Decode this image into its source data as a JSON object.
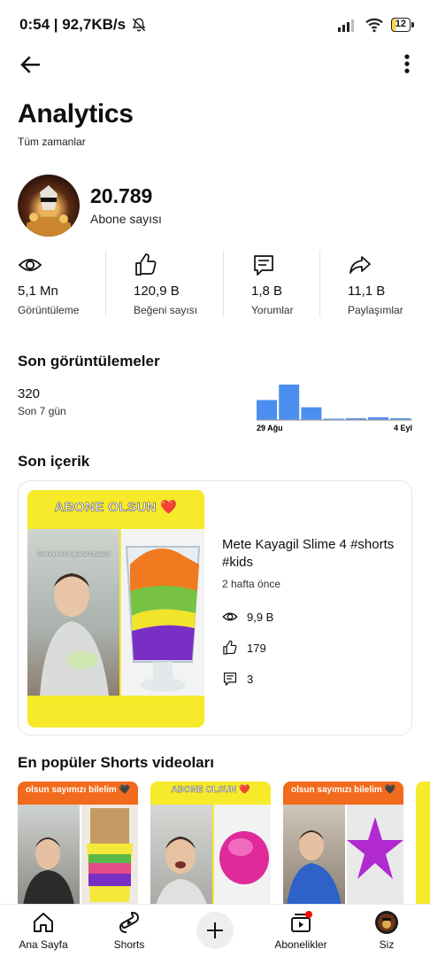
{
  "status_bar": {
    "time_speed": "0:54 | 92,7KB/s",
    "battery": "12"
  },
  "header": {
    "title": "Analytics",
    "subtitle": "Tüm zamanlar"
  },
  "channel": {
    "subscribers": "20.789",
    "subscribers_label": "Abone sayısı"
  },
  "stats": [
    {
      "value": "5,1 Mn",
      "label": "Görüntüleme",
      "icon": "eye-icon"
    },
    {
      "value": "120,9 B",
      "label": "Beğeni sayısı",
      "icon": "thumbs-up-icon"
    },
    {
      "value": "1,8 B",
      "label": "Yorumlar",
      "icon": "comment-icon"
    },
    {
      "value": "11,1 B",
      "label": "Paylaşımlar",
      "icon": "share-icon"
    }
  ],
  "recent_views": {
    "heading": "Son görüntülemeler",
    "value": "320",
    "period": "Son 7 gün",
    "chart_data": {
      "type": "bar",
      "x_start_label": "29 Ağu",
      "x_end_label": "4 Eyl",
      "values": [
        22,
        39,
        14,
        1,
        2,
        3,
        2
      ],
      "colors": {
        "bar": "#4a8ef0",
        "baseline": "#9e9e9e"
      }
    }
  },
  "recent_content": {
    "heading": "Son içerik",
    "thumbnail_banner": "ABONE OLSUN ❤️",
    "thumbnail_caption": "Sınıfa yeni biri gelirse Ortaokul",
    "title": "Mete Kayagil Slime 4 #shorts #kids",
    "age": "2 hafta önce",
    "views": "9,9 B",
    "likes": "179",
    "comments": "3"
  },
  "popular_shorts": {
    "heading": "En popüler Shorts videoları",
    "items": [
      {
        "caption": "olsun sayımızı bilelim 🖤",
        "cap_color": "#f26a1b"
      },
      {
        "caption": "ABONE OLSUN ❤️",
        "cap_color": "#f6ea2b"
      },
      {
        "caption": "olsun sayımızı bilelim 🖤",
        "cap_color": "#f26a1b"
      }
    ]
  },
  "bottom_nav": {
    "home": "Ana Sayfa",
    "shorts": "Shorts",
    "subscriptions": "Abonelikler",
    "you": "Siz"
  },
  "colors": {
    "accent_red": "#ff0000",
    "chart_blue": "#4a8ef0"
  }
}
